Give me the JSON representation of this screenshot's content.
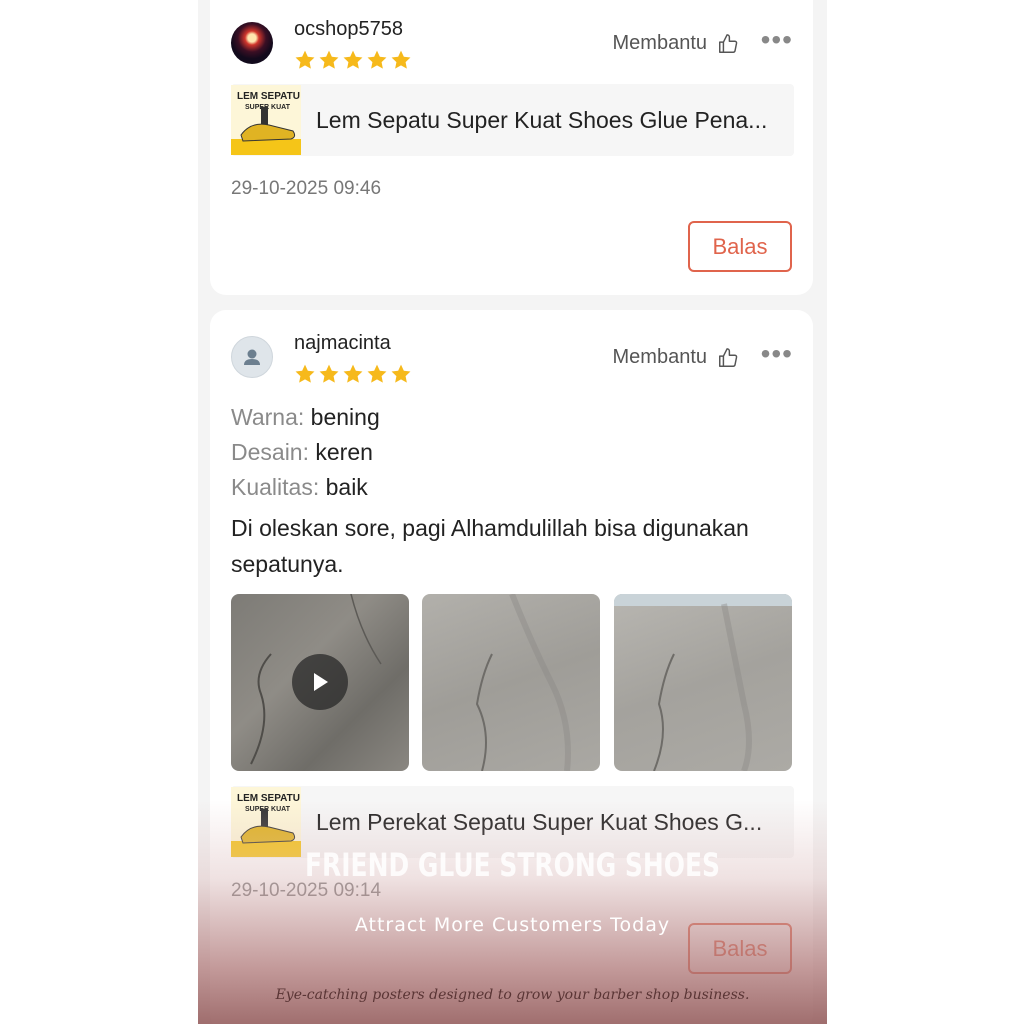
{
  "reviews": [
    {
      "username": "ocshop5758",
      "rating": 5,
      "helpful_label": "Membantu",
      "more_label": "•••",
      "product_name": "Lem Sepatu Super Kuat Shoes Glue Pena...",
      "date": "29-10-2025 09:46",
      "reply_label": "Balas"
    },
    {
      "username": "najmacinta",
      "rating": 5,
      "helpful_label": "Membantu",
      "more_label": "•••",
      "attributes": [
        {
          "key": "Warna:",
          "value": "bening"
        },
        {
          "key": "Desain:",
          "value": "keren"
        },
        {
          "key": "Kualitas:",
          "value": "baik"
        }
      ],
      "comment": "Di oleskan sore, pagi Alhamdulillah bisa digunakan sepatunya.",
      "product_name": "Lem Perekat Sepatu Super Kuat Shoes G...",
      "date": "29-10-2025 09:14",
      "reply_label": "Balas"
    }
  ],
  "overlay": {
    "title": "FRIEND GLUE STRONG SHOES",
    "subtitle": "Attract More Customers Today",
    "tagline": "Eye-catching posters designed to grow your barber shop business."
  },
  "colors": {
    "star": "#f6b91b",
    "accent": "#e0644c"
  }
}
